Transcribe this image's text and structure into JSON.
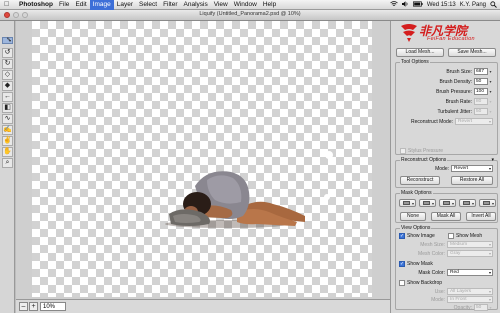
{
  "menubar": {
    "app": "Photoshop",
    "items": [
      "File",
      "Edit",
      "Image",
      "Layer",
      "Select",
      "Filter",
      "Analysis",
      "View",
      "Window",
      "Help"
    ],
    "active_item": "Image",
    "clock": "Wed 15:13",
    "user": "K.Y. Pang"
  },
  "window": {
    "title": "Liquify (Untitled_Panorama2.psd @ 10%)"
  },
  "status": {
    "zoom": "10%",
    "zoom_out": "–",
    "zoom_in": "+"
  },
  "watermark": "上海非凡进修学院|UI设计培训",
  "logo": {
    "main": "非凡学院",
    "sub": "FeiFan Education",
    "brand_color": "#d41d1d"
  },
  "panel": {
    "load_mesh": "Load Mesh...",
    "save_mesh": "Save Mesh...",
    "tool_options": {
      "title": "Tool Options",
      "fields": [
        {
          "label": "Brush Size:",
          "value": "687",
          "enabled": true
        },
        {
          "label": "Brush Density:",
          "value": "50",
          "enabled": true
        },
        {
          "label": "Brush Pressure:",
          "value": "100",
          "enabled": true
        },
        {
          "label": "Brush Rate:",
          "value": "80",
          "enabled": false
        },
        {
          "label": "Turbulent Jitter:",
          "value": "50",
          "enabled": false
        }
      ],
      "reconstruct_mode_label": "Reconstruct Mode:",
      "reconstruct_mode_value": "Revert",
      "stylus_pressure": "Stylus Pressure"
    },
    "reconstruct_options": {
      "title": "Reconstruct Options",
      "mode_label": "Mode:",
      "mode_value": "Revert",
      "reconstruct": "Reconstruct",
      "restore_all": "Restore All"
    },
    "mask_options": {
      "title": "Mask Options",
      "none": "None",
      "mask_all": "Mask All",
      "invert_all": "Invert All"
    },
    "view_options": {
      "title": "View Options",
      "show_image": "Show Image",
      "show_mesh": "Show Mesh",
      "mesh_size_label": "Mesh Size:",
      "mesh_size_value": "Medium",
      "mesh_color_label": "Mesh Color:",
      "mesh_color_value": "Gray",
      "show_mask": "Show Mask",
      "mask_color_label": "Mask Color:",
      "mask_color_value": "Red",
      "show_backdrop": "Show Backdrop",
      "use_label": "Use:",
      "use_value": "All Layers",
      "mode_label": "Mode:",
      "mode_value": "In Front",
      "opacity_label": "Opacity:",
      "opacity_value": "50"
    }
  },
  "icons": [
    "apple-icon",
    "wifi-icon",
    "volume-icon",
    "battery-icon",
    "search-icon",
    "forward-warp-tool-icon",
    "reconstruct-tool-icon",
    "twirl-tool-icon",
    "pucker-tool-icon",
    "bloat-tool-icon",
    "push-left-tool-icon",
    "mirror-tool-icon",
    "turbulence-tool-icon",
    "freeze-mask-tool-icon",
    "thaw-mask-tool-icon",
    "hand-tool-icon",
    "zoom-tool-icon"
  ]
}
